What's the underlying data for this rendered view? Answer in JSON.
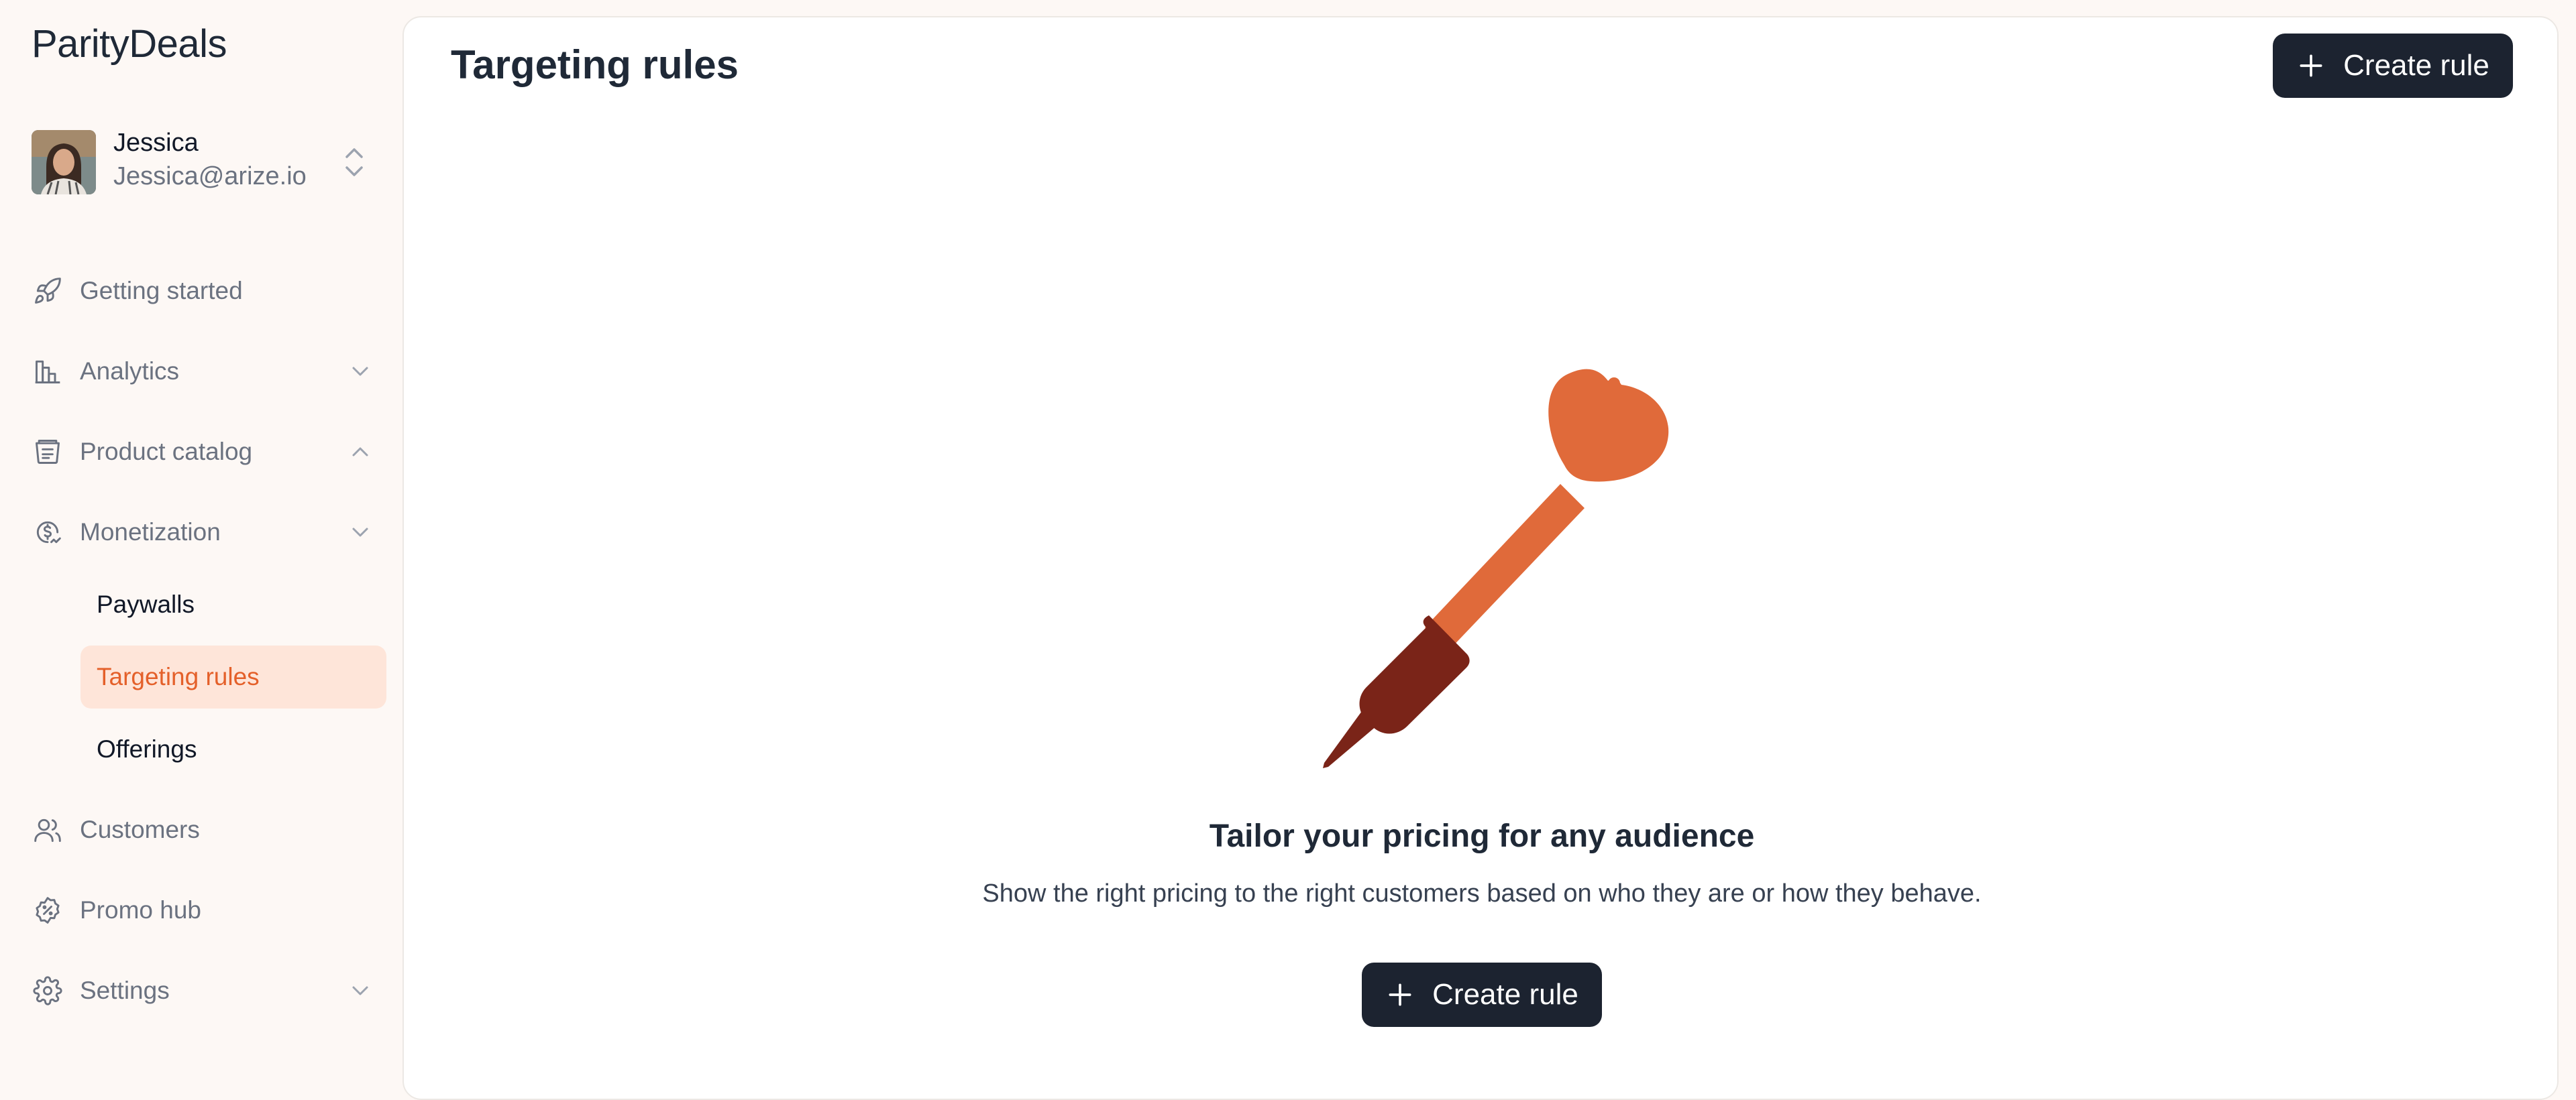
{
  "brand": {
    "logo": "ParityDeals"
  },
  "user": {
    "name": "Jessica",
    "email": "Jessica@arize.io"
  },
  "sidebar": {
    "items": [
      {
        "label": "Getting started",
        "icon": "rocket-icon"
      },
      {
        "label": "Analytics",
        "icon": "bar-chart-icon",
        "chevron": "down"
      },
      {
        "label": "Product catalog",
        "icon": "catalog-icon",
        "chevron": "up"
      },
      {
        "label": "Monetization",
        "icon": "dollar-circle-icon",
        "chevron": "down"
      },
      {
        "label": "Customers",
        "icon": "users-icon"
      },
      {
        "label": "Promo hub",
        "icon": "badge-icon"
      },
      {
        "label": "Settings",
        "icon": "gear-icon",
        "chevron": "down"
      }
    ],
    "subitems": [
      {
        "label": "Paywalls",
        "active": false
      },
      {
        "label": "Targeting rules",
        "active": true
      },
      {
        "label": "Offerings",
        "active": false
      }
    ]
  },
  "header": {
    "title": "Targeting rules",
    "create_label": "Create rule"
  },
  "empty_state": {
    "title": "Tailor your pricing for any audience",
    "description": "Show the right pricing to the right customers based on who they are or how they behave.",
    "create_label": "Create rule",
    "illustration": "dart-icon"
  },
  "colors": {
    "accent": "#e4602a",
    "accent_bg": "#fee5d9",
    "button_bg": "#1c2330",
    "dart_head": "#e06a3a",
    "dart_grip": "#7a2418"
  }
}
